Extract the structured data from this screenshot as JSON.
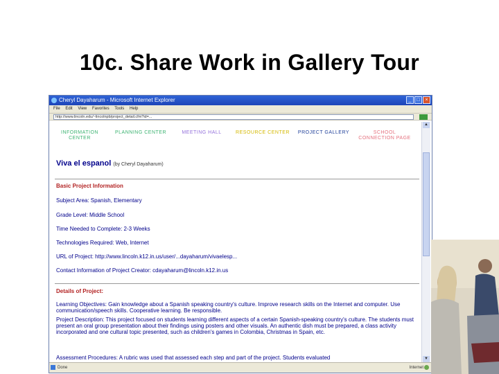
{
  "slide": {
    "title": "10c. Share Work in Gallery Tour"
  },
  "browser": {
    "title": "Cheryl Dayaharum - Microsoft Internet Explorer",
    "menu": [
      "File",
      "Edit",
      "View",
      "Favorites",
      "Tools",
      "Help"
    ],
    "address": "http://www.lincoln.edu/~lincolnpb/project_detail.cfm?id=..."
  },
  "nav": [
    {
      "label": "INFORMATION CENTER",
      "color": "#3cb371"
    },
    {
      "label": "PLANNING CENTER",
      "color": "#3cb371"
    },
    {
      "label": "MEETING HALL",
      "color": "#9370db"
    },
    {
      "label": "RESOURCE CENTER",
      "color": "#d4b800"
    },
    {
      "label": "PROJECT GALLERY",
      "color": "#1f3f9a"
    },
    {
      "label": "SCHOOL CONNECTION PAGE",
      "color": "#e5707d"
    }
  ],
  "site": {
    "title": "Viva el espanol",
    "by": "(by Cheryl Dayaharum)"
  },
  "basic": {
    "heading": "Basic Project Information",
    "subject": "Subject Area: Spanish, Elementary",
    "grade": "Grade Level: Middle School",
    "time": "Time Needed to Complete: 2-3 Weeks",
    "tech": "Technologies Required: Web, Internet",
    "url": "URL of Project: http://www.lincoln.k12.in.us/user/...dayaharum/vivaelesp...",
    "contact": "Contact Information of Project Creator: cdayaharum@lincoln.k12.in.us"
  },
  "details": {
    "heading": "Details of Project:",
    "objectives": "Learning Objectives: Gain knowledge about a Spanish speaking country's culture. Improve research skills on the Internet and computer. Use communication/speech skills. Cooperative learning. Be responsible.",
    "description": "Project Description: This project focused on students learning different aspects of a certain Spanish-speaking country's culture. The students must present an oral group presentation about their findings using posters and other visuals. An authentic dish must be prepared, a class activity incorporated and one cultural topic presented, such as children's games in Colombia, Christmas in Spain, etc.",
    "assessment": "Assessment Procedures: A rubric was used that assessed each step and part of the project. Students evaluated"
  },
  "status": {
    "left": "Done",
    "right": "Internet"
  },
  "colors": {
    "titlebar": "#2456c8",
    "heading": "#b22222",
    "body": "#00008b"
  }
}
